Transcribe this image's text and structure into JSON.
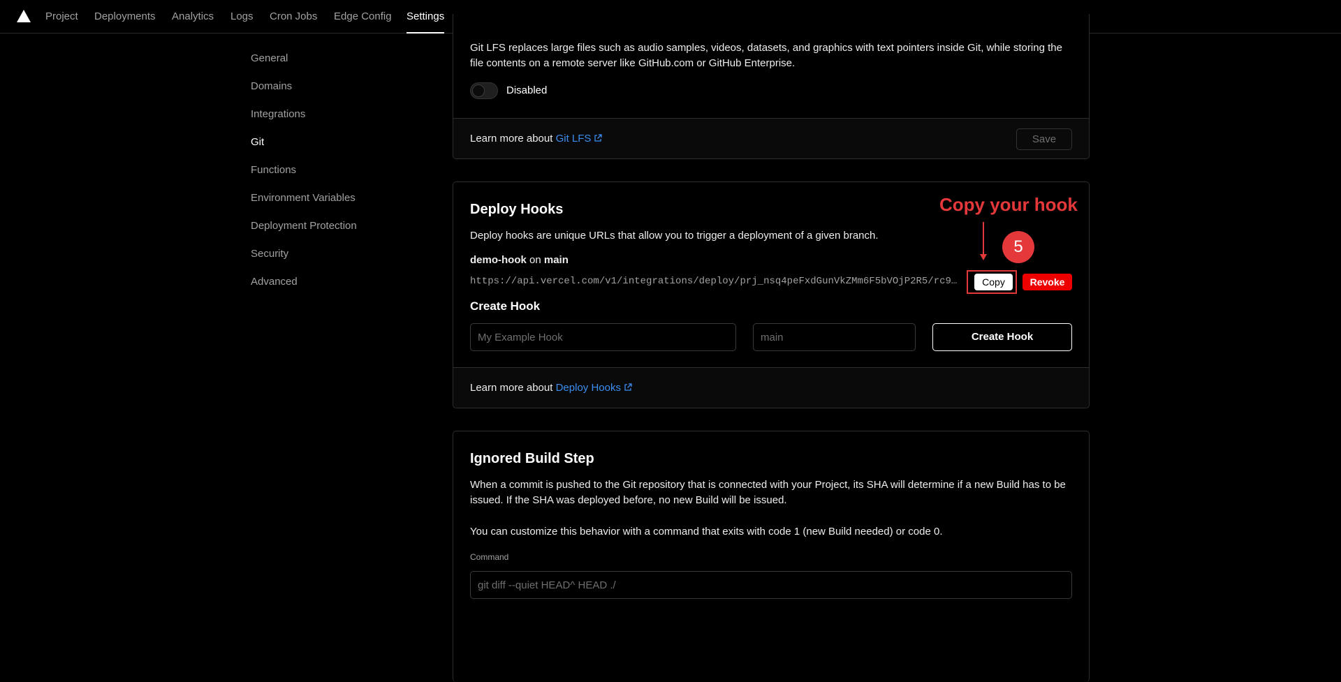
{
  "nav": {
    "tabs": [
      {
        "label": "Project"
      },
      {
        "label": "Deployments"
      },
      {
        "label": "Analytics"
      },
      {
        "label": "Logs"
      },
      {
        "label": "Cron Jobs"
      },
      {
        "label": "Edge Config"
      },
      {
        "label": "Settings",
        "active": true
      }
    ]
  },
  "sidebar": {
    "items": [
      {
        "label": "General"
      },
      {
        "label": "Domains"
      },
      {
        "label": "Integrations"
      },
      {
        "label": "Git",
        "active": true
      },
      {
        "label": "Functions"
      },
      {
        "label": "Environment Variables"
      },
      {
        "label": "Deployment Protection"
      },
      {
        "label": "Security"
      },
      {
        "label": "Advanced"
      }
    ]
  },
  "git_lfs": {
    "description": "Git LFS replaces large files such as audio samples, videos, datasets, and graphics with text pointers inside Git, while storing the file contents on a remote server like GitHub.com or GitHub Enterprise.",
    "toggle_label": "Disabled",
    "learn_prefix": "Learn more about",
    "learn_link": "Git LFS",
    "save_label": "Save"
  },
  "deploy_hooks": {
    "title": "Deploy Hooks",
    "description": "Deploy hooks are unique URLs that allow you to trigger a deployment of a given branch.",
    "hook": {
      "name": "demo-hook",
      "on": "on",
      "branch": "main",
      "url": "https://api.vercel.com/v1/integrations/deploy/prj_nsq4peFxdGunVkZMm6F5bVOjP2R5/rc9…"
    },
    "copy_label": "Copy",
    "revoke_label": "Revoke",
    "create_title": "Create Hook",
    "name_placeholder": "My Example Hook",
    "branch_placeholder": "main",
    "create_label": "Create Hook",
    "learn_prefix": "Learn more about",
    "learn_link": "Deploy Hooks"
  },
  "annotation": {
    "label": "Copy your hook",
    "step": "5",
    "color": "#e5383b"
  },
  "ignored_build": {
    "title": "Ignored Build Step",
    "description": "When a commit is pushed to the Git repository that is connected with your Project, its SHA will determine if a new Build has to be issued. If the SHA was deployed before, no new Build will be issued.",
    "custom_text": "You can customize this behavior with a command that exits with code 1 (new Build needed) or code 0.",
    "command_label": "Command",
    "command_placeholder": "git diff --quiet HEAD^ HEAD ./"
  },
  "colors": {
    "link": "#3b8df0",
    "revoke": "#ee0000",
    "annotation": "#e5383b"
  }
}
